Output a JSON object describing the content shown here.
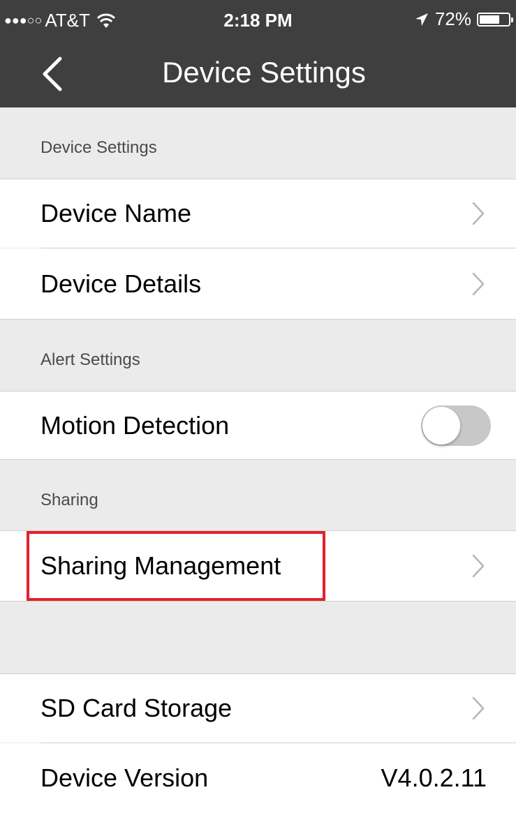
{
  "status_bar": {
    "signal": "●●●○○",
    "carrier": "AT&T",
    "wifi_icon": "wifi-icon",
    "time": "2:18 PM",
    "location_icon": "location-arrow-icon",
    "battery_percent": "72%",
    "battery_level": 0.72
  },
  "nav": {
    "back_icon": "chevron-left-icon",
    "title": "Device Settings"
  },
  "sections": {
    "device_settings": {
      "header": "Device Settings",
      "device_name": "Device Name",
      "device_details": "Device Details"
    },
    "alert_settings": {
      "header": "Alert Settings",
      "motion_detection": "Motion Detection",
      "motion_detection_enabled": false
    },
    "sharing": {
      "header": "Sharing",
      "sharing_management": "Sharing Management"
    },
    "storage": {
      "sd_card_storage": "SD Card Storage",
      "device_version_label": "Device Version",
      "device_version_value": "V4.0.2.11"
    }
  },
  "colors": {
    "nav_background": "#3f3f3f",
    "highlight_box": "#e2212c"
  }
}
